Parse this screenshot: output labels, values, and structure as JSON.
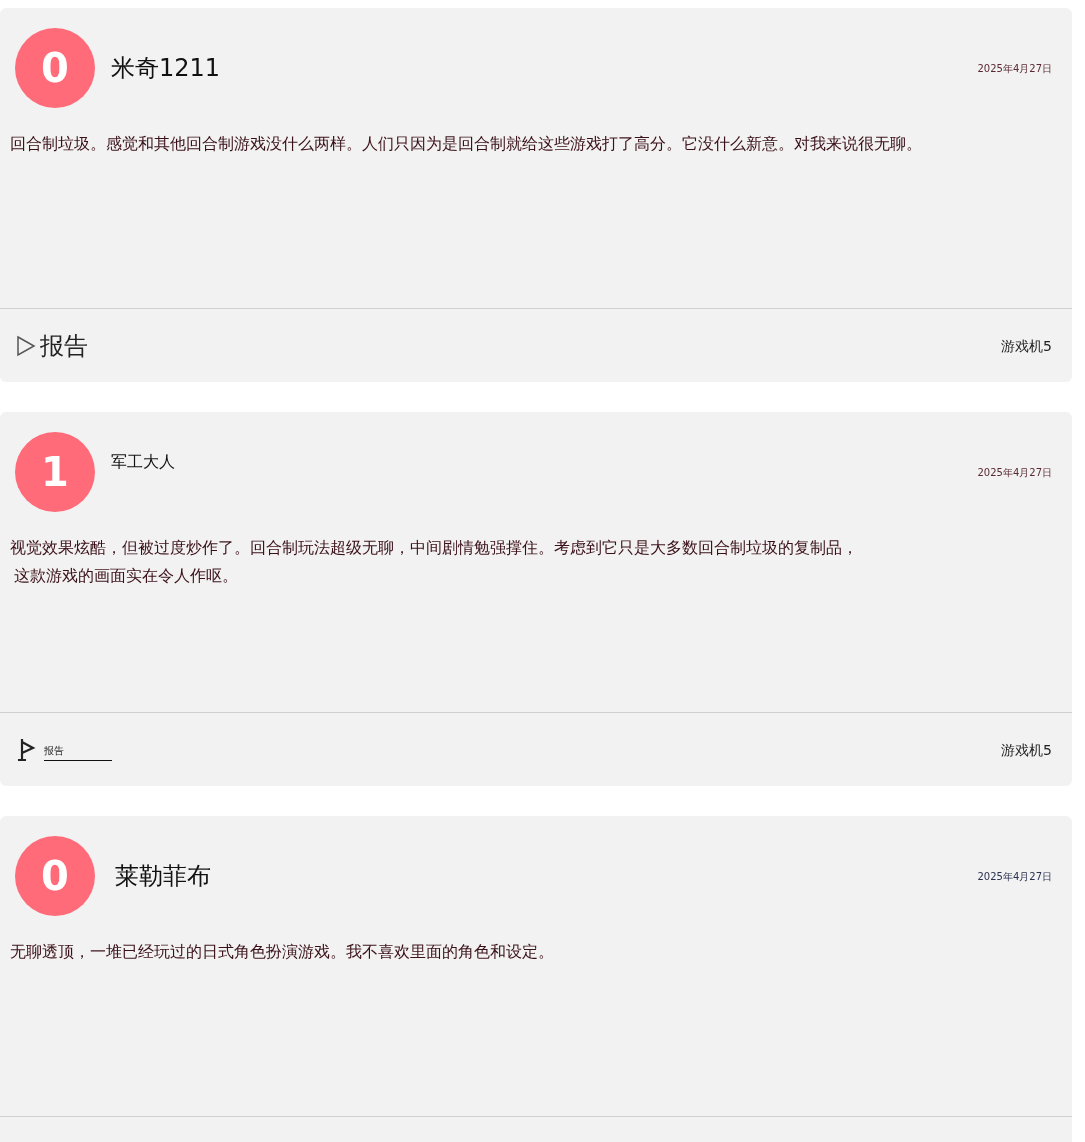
{
  "reviews": [
    {
      "score": "0",
      "name": "米奇1211",
      "date": "2025年4月27日",
      "lines": [
        "回合制垃圾。感觉和其他回合制游戏没什么两样。人们只因为是回合制就给这些游戏打了高分。它没什么新意。对我来说很无聊。"
      ],
      "footer": {
        "report": {
          "kind": "triangle",
          "label": "报告"
        },
        "platform": "游戏机5"
      }
    },
    {
      "score": "1",
      "name": "军工大人",
      "date": "2025年4月27日",
      "lines": [
        "视觉效果炫酷，但被过度炒作了。回合制玩法超级无聊，中间剧情勉强撑住。考虑到它只是大多数回合制垃圾的复制品，",
        "这款游戏的画面实在令人作呕。"
      ],
      "footer": {
        "report": {
          "kind": "flag",
          "label": "报告"
        },
        "platform": "游戏机5"
      }
    },
    {
      "score": "0",
      "name": "莱勒菲布",
      "date": "2025年4月27日",
      "lines": [
        "无聊透顶，一堆已经玩过的日式角色扮演游戏。我不喜欢里面的角色和设定。"
      ]
    }
  ]
}
